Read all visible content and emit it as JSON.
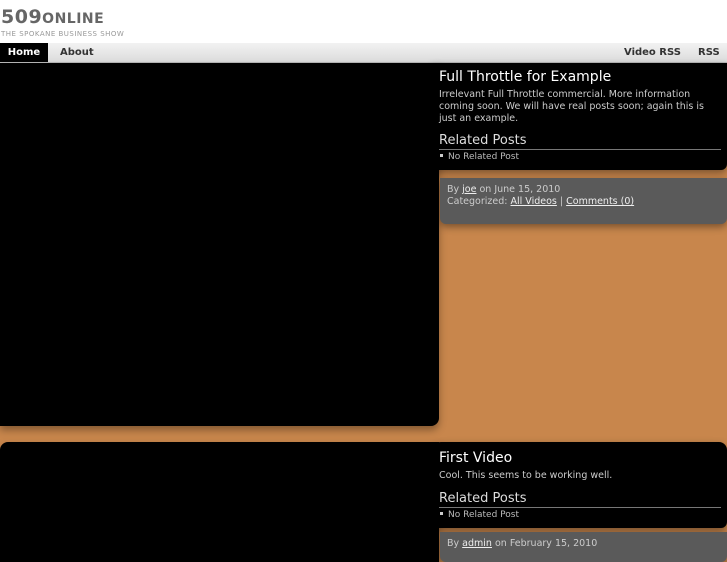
{
  "site": {
    "logo_main": "509",
    "logo_rest": "ONLINE",
    "tagline": "THE SPOKANE BUSINESS SHOW"
  },
  "nav": {
    "home": "Home",
    "about": "About",
    "video_rss": "Video RSS",
    "rss": "RSS"
  },
  "posts": [
    {
      "title": "Full Throttle for Example",
      "excerpt": "Irrelevant Full Throttle commercial. More information coming soon. We will have real posts soon; again this is just an example.",
      "related_heading": "Related Posts",
      "related_item": "No Related Post",
      "by_label": "By ",
      "author": "joe",
      "date_text": " on June 15, 2010",
      "categorized_label": "Categorized: ",
      "category": "All Videos",
      "separator": " | ",
      "comments": "Comments (0)"
    },
    {
      "title": "First Video",
      "excerpt": "Cool. This seems to be working well.",
      "related_heading": "Related Posts",
      "related_item": "No Related Post",
      "by_label": "By ",
      "author": "admin",
      "date_text": " on February 15, 2010"
    }
  ]
}
